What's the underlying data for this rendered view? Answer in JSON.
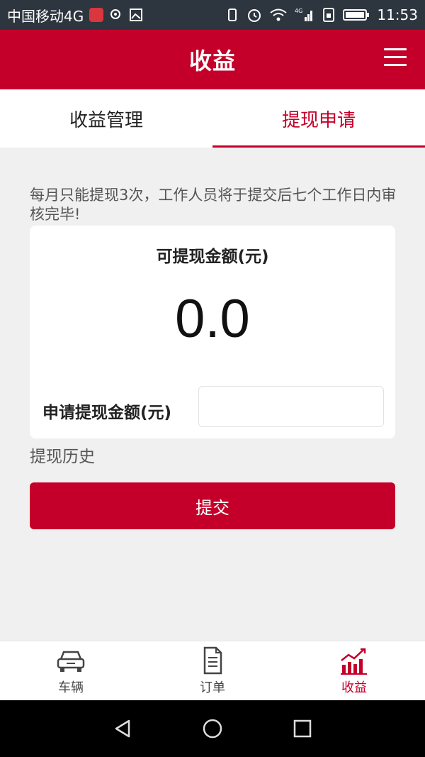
{
  "status_bar": {
    "carrier": "中国移动4G",
    "time": "11:53",
    "network": "4G"
  },
  "app_bar": {
    "title": "收益"
  },
  "tabs": [
    {
      "label": "收益管理",
      "active": false
    },
    {
      "label": "提现申请",
      "active": true
    }
  ],
  "notice": "每月只能提现3次，工作人员将于提交后七个工作日内审核完毕!",
  "card": {
    "available_label": "可提现金额(元)",
    "available_amount": "0.0",
    "request_label": "申请提现金额(元)",
    "request_value": ""
  },
  "history_link": "提现历史",
  "submit_label": "提交",
  "bottom_nav": [
    {
      "label": "车辆",
      "icon": "car-icon",
      "active": false
    },
    {
      "label": "订单",
      "icon": "document-icon",
      "active": false
    },
    {
      "label": "收益",
      "icon": "chart-icon",
      "active": true
    }
  ],
  "colors": {
    "brand": "#c4002a",
    "status_bar": "#2d353f",
    "background": "#f0f0f0"
  }
}
